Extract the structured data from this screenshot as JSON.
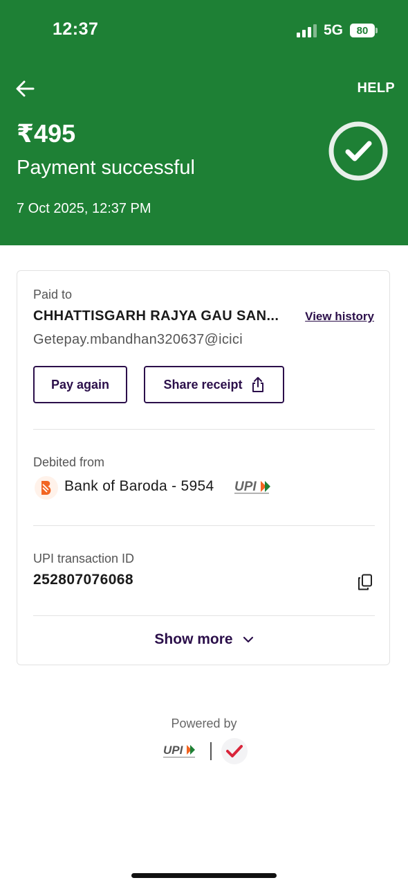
{
  "status_bar": {
    "time": "12:37",
    "network": "5G",
    "battery": "80"
  },
  "header": {
    "help_label": "HELP",
    "amount": "₹495",
    "title": "Payment successful",
    "datetime": "7 Oct 2025, 12:37 PM"
  },
  "paid_to": {
    "label": "Paid to",
    "name": "CHHATTISGARH RAJYA GAU SAN...",
    "view_history": "View history",
    "upi_id": "Getepay.mbandhan320637@icici",
    "pay_again": "Pay again",
    "share_receipt": "Share receipt"
  },
  "debited_from": {
    "label": "Debited from",
    "account": "Bank of Baroda - 5954"
  },
  "transaction": {
    "label": "UPI transaction ID",
    "id": "252807076068"
  },
  "show_more": "Show more",
  "footer": {
    "powered_by": "Powered by"
  },
  "colors": {
    "header_green": "#1e8035",
    "accent_purple": "#2b0f4a",
    "bank_orange": "#f26522"
  },
  "icons": [
    "back-arrow-icon",
    "check-circle-icon",
    "share-icon",
    "bank-of-baroda-logo",
    "upi-logo",
    "copy-icon",
    "chevron-down-icon",
    "npci-logo"
  ]
}
